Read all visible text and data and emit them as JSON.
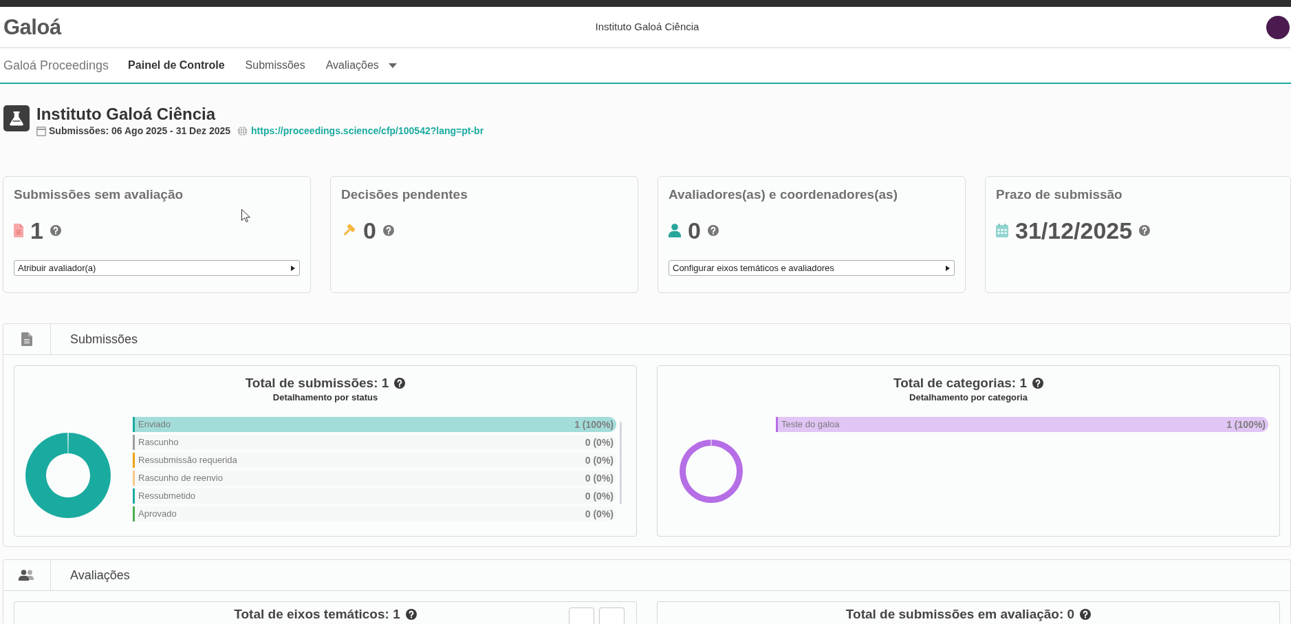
{
  "header": {
    "logo": "Galoá",
    "title": "Instituto Galoá Ciência"
  },
  "nav": {
    "brand": "Galoá Proceedings",
    "items": [
      {
        "label": "Painel de Controle",
        "selected": true,
        "dropdown": false
      },
      {
        "label": "Submissões",
        "selected": false,
        "dropdown": false
      },
      {
        "label": "Avaliações",
        "selected": false,
        "dropdown": true
      }
    ]
  },
  "event": {
    "title": "Instituto Galoá Ciência",
    "period": "Submissões: 06 Ago 2025 - 31 Dez 2025",
    "link": "https://proceedings.science/cfp/100542?lang=pt-br"
  },
  "stat_cards": [
    {
      "title": "Submissões sem avaliação",
      "kind": "document",
      "value": "1",
      "action": "Atribuir avaliador(a)"
    },
    {
      "title": "Decisões pendentes",
      "kind": "gavel",
      "value": "0"
    },
    {
      "title": "Avaliadores(as) e coordenadores(as)",
      "kind": "person",
      "value": "0",
      "action": "Configurar eixos temáticos e avaliadores"
    },
    {
      "title": "Prazo de submissão",
      "kind": "calendar",
      "value": "31/12/2025"
    }
  ],
  "sections": [
    {
      "title": "Submissões",
      "kind": "document",
      "panels": [
        {
          "title": "Total de submissões: 1",
          "subtitle": "Detalhamento por status",
          "scrollable": true,
          "items": [
            {
              "label": "Enviado",
              "value": "1 (100%)",
              "level": 1,
              "color": "#1aaba0"
            },
            {
              "label": "Rascunho",
              "value": "0 (0%)",
              "level": 0,
              "color": "#9e9e9e"
            },
            {
              "label": "Ressubmissão requerida",
              "value": "0 (0%)",
              "level": 0,
              "color": "#f0a30a"
            },
            {
              "label": "Rascunho de reenvio",
              "value": "0 (0%)",
              "level": 0,
              "color": "#f8c98a"
            },
            {
              "label": "Ressubmetido",
              "value": "0 (0%)",
              "level": 0,
              "color": "#1aaba0"
            },
            {
              "label": "Aprovado",
              "value": "0 (0%)",
              "level": 0,
              "color": "#4caf50"
            }
          ]
        },
        {
          "title": "Total de categorias: 1",
          "subtitle": "Detalhamento por categoria",
          "items": [
            {
              "label": "Teste do galoa",
              "value": "1 (100%)",
              "level": 1,
              "color": "#b56ee6"
            }
          ]
        }
      ]
    },
    {
      "title": "Avaliações",
      "kind": "users",
      "panels": [
        {
          "title": "Total de eixos temáticos: 1",
          "controls": [
            {
              "kind": "button"
            },
            {
              "kind": "button"
            }
          ]
        },
        {
          "title": "Total de submissões em avaliação: 0"
        }
      ]
    }
  ]
}
